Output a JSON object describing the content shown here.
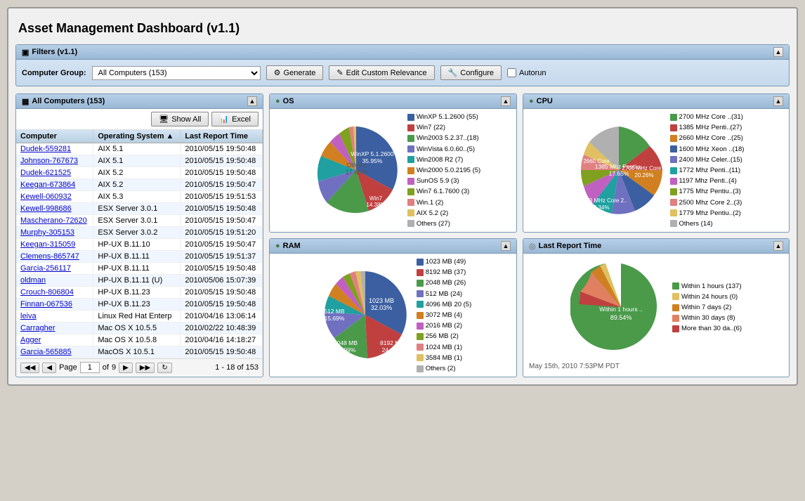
{
  "title": "Asset Management Dashboard (v1.1)",
  "filters": {
    "header": "Filters (v1.1)",
    "computer_group_label": "Computer Group:",
    "computer_group_value": "All Computers (153)",
    "generate_label": "Generate",
    "edit_custom_label": "Edit Custom Relevance",
    "configure_label": "Configure",
    "autorun_label": "Autorun"
  },
  "os_panel": {
    "title": "OS",
    "chart_title": "OS",
    "legend": [
      {
        "label": "WinXP 5.1.2600 (55)",
        "color": "#3b5fa0"
      },
      {
        "label": "Win7 (22)",
        "color": "#c04040"
      },
      {
        "label": "Win2003 5.2.37..(18)",
        "color": "#4a9a4a"
      },
      {
        "label": "WinVista 6.0.60..(5)",
        "color": "#7070c0"
      },
      {
        "label": "Win2008 R2 (7)",
        "color": "#20a0a0"
      },
      {
        "label": "Win2000 5.0.2195 (5)",
        "color": "#d08020"
      },
      {
        "label": "SunOS 5.9 (3)",
        "color": "#c060c0"
      },
      {
        "label": "Win7 6.1.7600 (3)",
        "color": "#80a020"
      },
      {
        "label": "Win.1 (2)",
        "color": "#e08080"
      },
      {
        "label": "AIX 5.2 (2)",
        "color": "#e0c060"
      },
      {
        "label": "Others (27)",
        "color": "#b0b0b0"
      }
    ]
  },
  "cpu_panel": {
    "title": "CPU",
    "chart_title": "CPU",
    "legend": [
      {
        "label": "2700 MHz Core ..(31)",
        "color": "#4a9a4a"
      },
      {
        "label": "1385 MHz Penti..(27)",
        "color": "#c04040"
      },
      {
        "label": "2660 MHz Core ..(25)",
        "color": "#d08020"
      },
      {
        "label": "1600 MHz Xeon ..(18)",
        "color": "#3b5fa0"
      },
      {
        "label": "2400 MHz Celer..(15)",
        "color": "#7070c0"
      },
      {
        "label": "1772 Mhz Penti..(11)",
        "color": "#20a0a0"
      },
      {
        "label": "1197 Mhz Penti..(4)",
        "color": "#c060c0"
      },
      {
        "label": "1775 Mhz Pentiu..(3)",
        "color": "#80a020"
      },
      {
        "label": "2500 Mhz Core 2..(3)",
        "color": "#e08080"
      },
      {
        "label": "1779 Mhz Pentiu..(2)",
        "color": "#e0c060"
      },
      {
        "label": "Others (14)",
        "color": "#b0b0b0"
      }
    ]
  },
  "ram_panel": {
    "title": "RAM",
    "chart_title": "RAM",
    "legend": [
      {
        "label": "1023 MB (49)",
        "color": "#3b5fa0"
      },
      {
        "label": "8192 MB (37)",
        "color": "#c04040"
      },
      {
        "label": "2048 MB (26)",
        "color": "#4a9a4a"
      },
      {
        "label": "512 MB (24)",
        "color": "#7070c0"
      },
      {
        "label": "4096 MB 20 (5)",
        "color": "#20a0a0"
      },
      {
        "label": "3072 MB (4)",
        "color": "#d08020"
      },
      {
        "label": "2016 MB (2)",
        "color": "#c060c0"
      },
      {
        "label": "256 MB (2)",
        "color": "#80a020"
      },
      {
        "label": "1024 MB (1)",
        "color": "#e08080"
      },
      {
        "label": "3584 MB (1)",
        "color": "#e0c060"
      },
      {
        "label": "Others (2)",
        "color": "#b0b0b0"
      }
    ]
  },
  "last_report_panel": {
    "title": "Last Report Time",
    "chart_title": "Last Report Time",
    "legend": [
      {
        "label": "Within 1 hours (137)",
        "color": "#4a9a4a"
      },
      {
        "label": "Within 24 hours (0)",
        "color": "#e0c060"
      },
      {
        "label": "Within 7 days (2)",
        "color": "#d08020"
      },
      {
        "label": "Within 30 days (8)",
        "color": "#e08060"
      },
      {
        "label": "More than 30 da..(6)",
        "color": "#c04040"
      }
    ],
    "center_label": "Within 1 hours ..",
    "center_pct": "89.54%"
  },
  "table_panel": {
    "title": "All Computers (153)",
    "show_all_label": "Show All",
    "excel_label": "Excel",
    "columns": [
      "Computer",
      "Operating System",
      "Last Report Time"
    ],
    "rows": [
      {
        "computer": "Dudek-559281",
        "os": "AIX 5.1",
        "time": "2010/05/15 19:50:48"
      },
      {
        "computer": "Johnson-767673",
        "os": "AIX 5.1",
        "time": "2010/05/15 19:50:48"
      },
      {
        "computer": "Dudek-621525",
        "os": "AIX 5.2",
        "time": "2010/05/15 19:50:48"
      },
      {
        "computer": "Keegan-673864",
        "os": "AIX 5.2",
        "time": "2010/05/15 19:50:47"
      },
      {
        "computer": "Kewell-060932",
        "os": "AIX 5.3",
        "time": "2010/05/15 19:51:53"
      },
      {
        "computer": "Kewell-998686",
        "os": "ESX Server 3.0.1",
        "time": "2010/05/15 19:50:48"
      },
      {
        "computer": "Mascherano-72620",
        "os": "ESX Server 3.0.1",
        "time": "2010/05/15 19:50:47"
      },
      {
        "computer": "Murphy-305153",
        "os": "ESX Server 3.0.2",
        "time": "2010/05/15 19:51:20"
      },
      {
        "computer": "Keegan-315059",
        "os": "HP-UX B.11.10",
        "time": "2010/05/15 19:50:47"
      },
      {
        "computer": "Clemens-865747",
        "os": "HP-UX B.11.11",
        "time": "2010/05/15 19:51:37"
      },
      {
        "computer": "Garcia-256117",
        "os": "HP-UX B.11.11",
        "time": "2010/05/15 19:50:48"
      },
      {
        "computer": "oldman",
        "os": "HP-UX B.11.11 (U)",
        "time": "2010/05/06 15:07:39"
      },
      {
        "computer": "Crouch-806804",
        "os": "HP-UX B.11.23",
        "time": "2010/05/15 19:50:48"
      },
      {
        "computer": "Finnan-067536",
        "os": "HP-UX B.11.23",
        "time": "2010/05/15 19:50:48"
      },
      {
        "computer": "leiva",
        "os": "Linux Red Hat Enterp",
        "time": "2010/04/16 13:06:14"
      },
      {
        "computer": "Carragher",
        "os": "Mac OS X 10.5.5",
        "time": "2010/02/22 10:48:39"
      },
      {
        "computer": "Agger",
        "os": "Mac OS X 10.5.8",
        "time": "2010/04/16 14:18:27"
      },
      {
        "computer": "Garcia-565885",
        "os": "MacOS X 10.5.1",
        "time": "2010/05/15 19:50:48"
      }
    ],
    "pagination": {
      "page_label": "Page",
      "current_page": "1",
      "total_pages": "9",
      "range_text": "1 - 18 of 153"
    }
  },
  "timestamp": "May 15th, 2010 7:53PM PDT",
  "icons": {
    "filter": "▣",
    "cpu": "◉",
    "os": "◉",
    "ram": "◉",
    "time": "◎",
    "table": "▦",
    "gear": "⚙",
    "key": "🔑",
    "excel": "📊",
    "expand": "▲",
    "collapse": "▼",
    "first": "◀◀",
    "prev": "◀",
    "next": "▶",
    "last": "▶▶",
    "refresh": "↻"
  }
}
